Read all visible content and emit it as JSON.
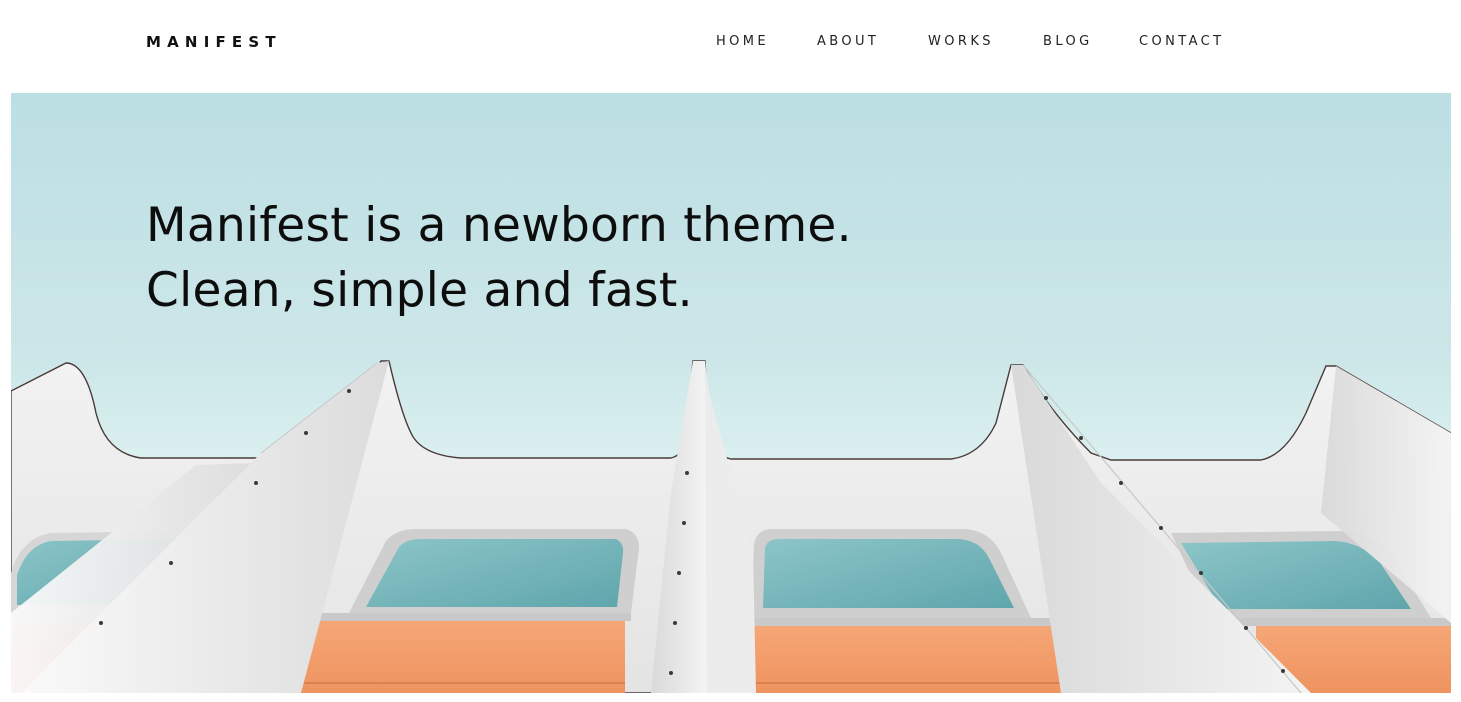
{
  "brand": {
    "logo_text": "MANIFEST"
  },
  "nav": {
    "items": [
      {
        "label": "HOME"
      },
      {
        "label": "ABOUT"
      },
      {
        "label": "WORKS"
      },
      {
        "label": "BLOG"
      },
      {
        "label": "CONTACT"
      }
    ]
  },
  "hero": {
    "headline_line1": "Manifest is a newborn theme.",
    "headline_line2": "Clean, simple and fast.",
    "image": "modern-building-facade-photo"
  },
  "colors": {
    "sky": "#c4e2e5",
    "facade": "#eeeeee",
    "window_glass": "#7fbcc0",
    "orange_panel": "#f3a070",
    "text": "#111111"
  }
}
